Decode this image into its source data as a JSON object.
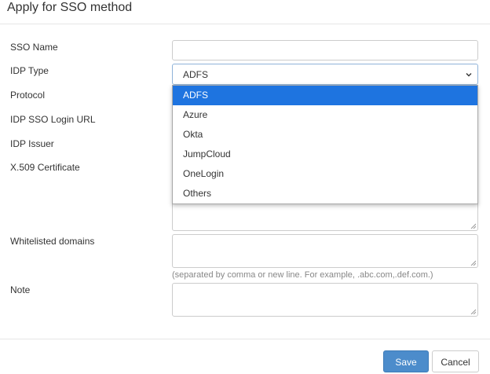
{
  "dialog": {
    "title": "Apply for SSO method"
  },
  "form": {
    "sso_name_label": "SSO Name",
    "idp_type_label": "IDP Type",
    "protocol_label": "Protocol",
    "idp_sso_login_url_label": "IDP SSO Login URL",
    "idp_issuer_label": "IDP Issuer",
    "certificate_label": "X.509 Certificate",
    "whitelisted_domains_label": "Whitelisted domains",
    "whitelisted_domains_help": "(separated by comma or new line. For example, .abc.com,.def.com.)",
    "note_label": "Note",
    "idp_type_value": "ADFS"
  },
  "idp_type_options": [
    {
      "label": "ADFS",
      "selected": true
    },
    {
      "label": "Azure",
      "selected": false
    },
    {
      "label": "Okta",
      "selected": false
    },
    {
      "label": "JumpCloud",
      "selected": false
    },
    {
      "label": "OneLogin",
      "selected": false
    },
    {
      "label": "Others",
      "selected": false
    }
  ],
  "footer": {
    "save_label": "Save",
    "cancel_label": "Cancel"
  },
  "colors": {
    "accent": "#1e74e0",
    "save_button": "#4c8ccb"
  },
  "icons": {
    "select_caret": "chevron-down-icon",
    "resize": "resize-grip-icon"
  }
}
